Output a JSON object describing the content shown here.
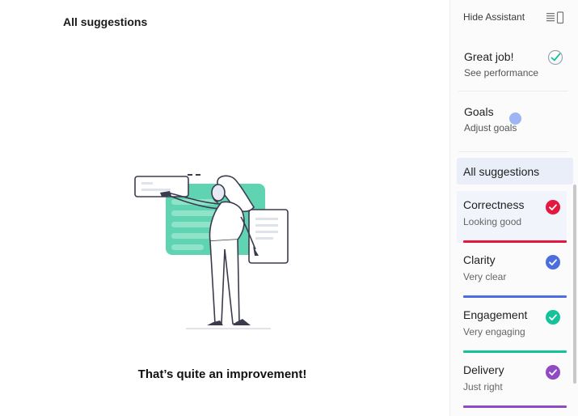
{
  "main": {
    "title": "All suggestions",
    "caption": "That’s quite an improvement!",
    "illustration_icon": "woman-presenting-illustration"
  },
  "sidebar": {
    "hide_assistant": "Hide Assistant",
    "hide_icon": "panel-toggle-icon",
    "performance": {
      "title": "Great job!",
      "subtitle": "See performance",
      "icon": "checkmark-circle-icon"
    },
    "goals": {
      "title": "Goals",
      "subtitle": "Adjust goals"
    },
    "all_suggestions": "All suggestions",
    "categories": [
      {
        "title": "Correctness",
        "status": "Looking good",
        "color": "#e5173f"
      },
      {
        "title": "Clarity",
        "status": "Very clear",
        "color": "#4a6ee0"
      },
      {
        "title": "Engagement",
        "status": "Very engaging",
        "color": "#15c39a"
      },
      {
        "title": "Delivery",
        "status": "Just right",
        "color": "#8f4ac4"
      }
    ]
  }
}
